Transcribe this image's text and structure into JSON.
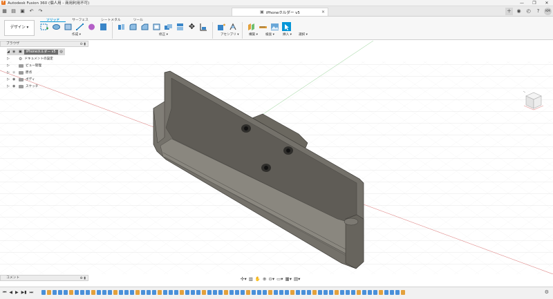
{
  "window": {
    "title": "Autodesk Fusion 360 (個人用 - 商用利用不可)",
    "logo_letter": "F",
    "minimize": "—",
    "maximize": "❐",
    "close": "✕"
  },
  "qbar": {
    "icons": [
      "grid-icon",
      "file-icon",
      "save-icon",
      "undo-icon",
      "redo-icon"
    ],
    "document_tab": "iPhoneホルダー v5",
    "avatar_initials": "KM"
  },
  "ribbon": {
    "workspace": "デザイン ▾",
    "tabs": [
      "ソリッド",
      "サーフェス",
      "シートメタル",
      "ツール"
    ],
    "active_tab": 0,
    "groups": {
      "create": "作成 ▾",
      "modify": "修正 ▾",
      "assemble": "アセンブリ ▾",
      "construct": "構築 ▾",
      "inspect": "検査 ▾",
      "insert": "挿入 ▾",
      "select": "選択 ▾"
    }
  },
  "browser": {
    "title": "ブラウザ",
    "root": "iPhoneホルダー v5",
    "items": [
      {
        "label": "ドキュメントの設定",
        "icon": "gear-icon"
      },
      {
        "label": "ビュー管理",
        "icon": "folder-icon"
      },
      {
        "label": "原点",
        "icon": "folder-icon"
      },
      {
        "label": "ボディ",
        "icon": "folder-icon"
      },
      {
        "label": "スケッチ",
        "icon": "folder-icon"
      }
    ]
  },
  "comments": {
    "title": "コメント"
  },
  "colors": {
    "accent": "#0696d7",
    "model_body": "#6f6c64",
    "model_inner": "#5f5c55",
    "axis_red": "#e06666",
    "axis_green": "#6fbf6f",
    "timeline_blue": "#4a90d9",
    "timeline_orange": "#e3a13c"
  },
  "timeline": {
    "count": 66
  }
}
